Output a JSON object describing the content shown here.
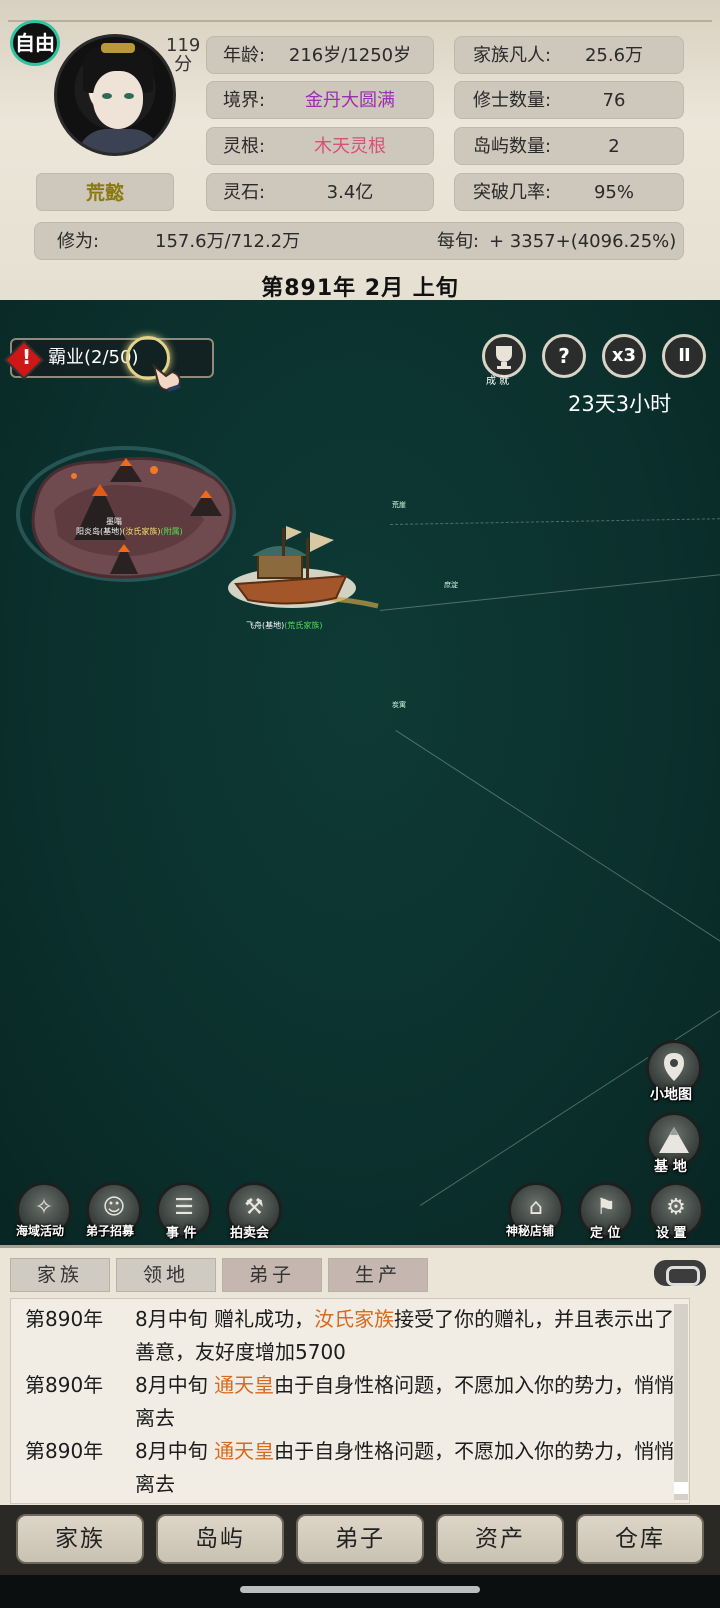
{
  "status": {
    "badge": "自由",
    "score_number": "119",
    "score_unit": "分",
    "name": "荒懿",
    "age_label": "年龄:",
    "age_value": "216岁/1250岁",
    "realm_label": "境界:",
    "realm_value": "金丹大圆满",
    "realm_color": "#9b2fb0",
    "root_label": "灵根:",
    "root_value": "木天灵根",
    "root_color": "#d9507b",
    "stone_label": "灵石:",
    "stone_value": "3.4亿",
    "mortals_label": "家族凡人:",
    "mortals_value": "25.6万",
    "cultivators_label": "修士数量:",
    "cultivators_value": "76",
    "islands_label": "岛屿数量:",
    "islands_value": "2",
    "breakthrough_label": "突破几率:",
    "breakthrough_value": "95%",
    "cultivation_label": "修为:",
    "cultivation_value": "157.6万/712.2万",
    "per_period_label": "每旬:",
    "per_period_value": "+ 3357+(4096.25%)"
  },
  "date": "第891年 2月 上旬",
  "map": {
    "hegemony_label": "霸业(2/50)",
    "alert_mark": "!",
    "achievement_label": "成 就",
    "help_label": "?",
    "speed_label": "x3",
    "pause_label": "II",
    "timer": "23天3小时",
    "island_name": "阳炎岛(基地)",
    "island_family": "(汝氏家族)",
    "island_relation": "(附属)",
    "island_sub": "墨嗡",
    "ship_name": "飞舟(基地)",
    "ship_family": "(荒氏家族)",
    "waypoints": [
      "炭寓",
      "庶淀",
      "荒崖"
    ]
  },
  "side_buttons": {
    "minimap": "小地图",
    "base": "基 地"
  },
  "bottom_left_buttons": [
    "海域活动",
    "弟子招募",
    "事 件",
    "拍卖会"
  ],
  "bottom_right_buttons": [
    "神秘店铺",
    "定 位",
    "设 置"
  ],
  "log": {
    "tabs": [
      "家族",
      "领地",
      "弟子",
      "生产"
    ],
    "entries": [
      {
        "year": "第890年",
        "pre": "8月中旬 赠礼成功，",
        "hl": "汝氏家族",
        "post": "接受了你的赠礼，并且表示出了善意，友好度增加5700"
      },
      {
        "year": "第890年",
        "pre": "8月中旬 ",
        "hl": "通天皇",
        "post": "由于自身性格问题，不愿加入你的势力，悄悄离去"
      },
      {
        "year": "第890年",
        "pre": "8月中旬 ",
        "hl": "通天皇",
        "post": "由于自身性格问题，不愿加入你的势力，悄悄离去"
      }
    ]
  },
  "nav": [
    "家族",
    "岛屿",
    "弟子",
    "资产",
    "仓库"
  ]
}
